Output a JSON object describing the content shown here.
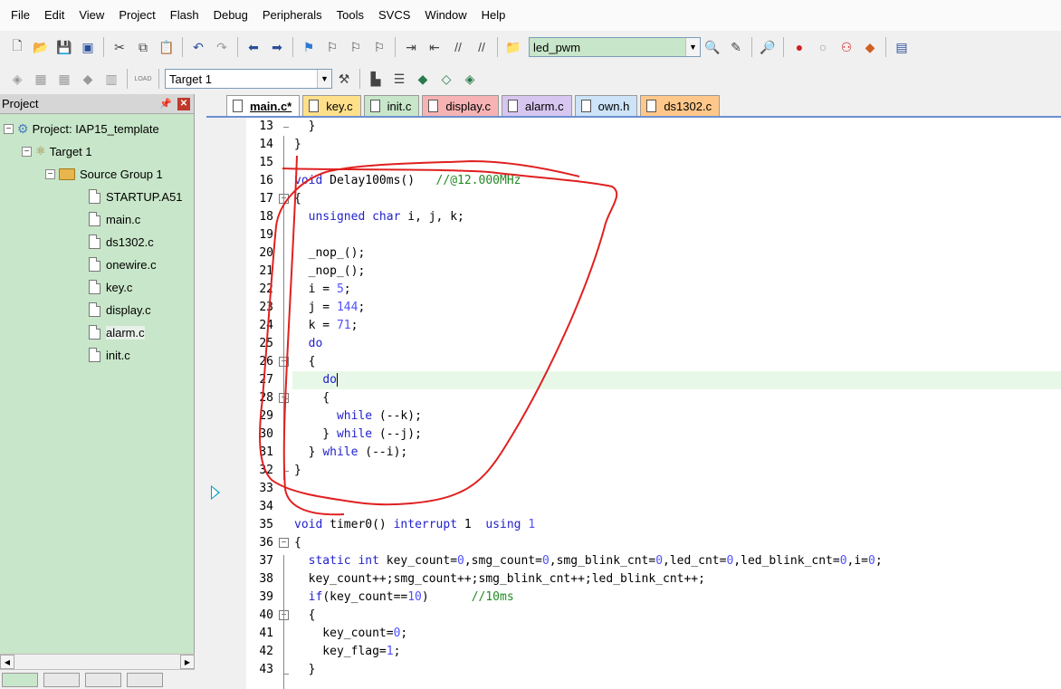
{
  "menubar": {
    "items": [
      "File",
      "Edit",
      "View",
      "Project",
      "Flash",
      "Debug",
      "Peripherals",
      "Tools",
      "SVCS",
      "Window",
      "Help"
    ]
  },
  "toolbar": {
    "project_combo_value": "led_pwm",
    "target_combo_value": "Target 1",
    "load_label": "LOAD"
  },
  "project_pane": {
    "title": "Project",
    "pin_icon": "pin-icon",
    "close_icon": "close-icon",
    "tree": {
      "project": "Project: IAP15_template",
      "target": "Target 1",
      "group": "Source Group 1",
      "files": [
        "STARTUP.A51",
        "main.c",
        "ds1302.c",
        "onewire.c",
        "key.c",
        "display.c",
        "alarm.c",
        "init.c"
      ],
      "selected_file": "alarm.c"
    }
  },
  "editor": {
    "tabs": [
      {
        "label": "main.c*",
        "active": true,
        "color": "#ffffff"
      },
      {
        "label": "key.c",
        "active": false,
        "color": "#ffe08a"
      },
      {
        "label": "init.c",
        "active": false,
        "color": "#c8e6c9"
      },
      {
        "label": "display.c",
        "active": false,
        "color": "#f7b3b3"
      },
      {
        "label": "alarm.c",
        "active": false,
        "color": "#d7c6f0"
      },
      {
        "label": "own.h",
        "active": false,
        "color": "#cde3f7"
      },
      {
        "label": "ds1302.c",
        "active": false,
        "color": "#ffc88a"
      }
    ],
    "line_numbers": [
      "13",
      "14",
      "15",
      "16",
      "17",
      "18",
      "19",
      "20",
      "21",
      "22",
      "23",
      "24",
      "25",
      "26",
      "27",
      "28",
      "29",
      "30",
      "31",
      "32",
      "33",
      "34",
      "35",
      "36",
      "37",
      "38",
      "39",
      "40",
      "41",
      "42",
      "43"
    ],
    "lines": [
      "  }",
      "}",
      "",
      "void Delay100ms()   //@12.000MHz",
      "{",
      "  unsigned char i, j, k;",
      "",
      "  _nop_();",
      "  _nop_();",
      "  i = 5;",
      "  j = 144;",
      "  k = 71;",
      "  do",
      "  {",
      "    do",
      "    {",
      "      while (--k);",
      "    } while (--j);",
      "  } while (--i);",
      "}",
      "",
      "",
      "void timer0() interrupt 1  using 1",
      "{",
      "  static int key_count=0,smg_count=0,smg_blink_cnt=0,led_cnt=0,led_blink_cnt=0,i=0;",
      "  key_count++;smg_count++;smg_blink_cnt++;led_blink_cnt++;",
      "  if(key_count==10)      //10ms",
      "  {",
      "    key_count=0;",
      "    key_flag=1;",
      "  }"
    ],
    "cursor_line": "27",
    "colors": {
      "keyword": "#2222cc",
      "comment": "#228b22",
      "number": "#5050ff",
      "cursor_line_bg": "#e8f8e8",
      "annotation": "#e02020"
    }
  }
}
